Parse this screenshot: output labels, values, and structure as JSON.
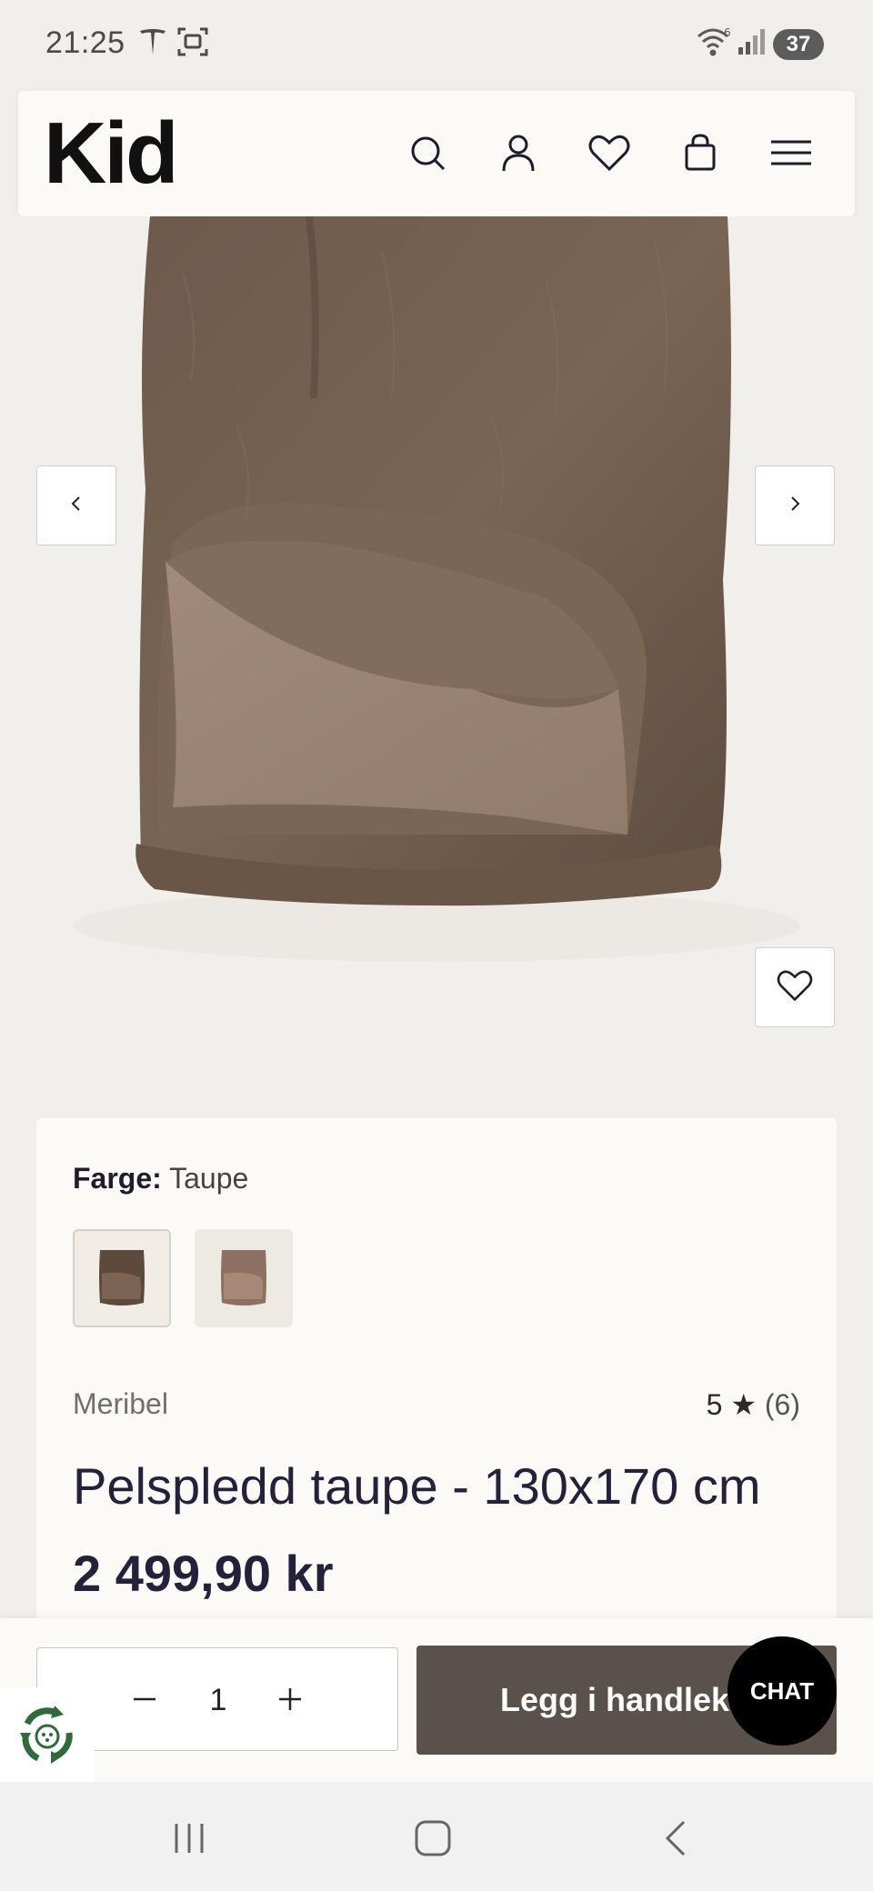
{
  "status_bar": {
    "time": "21:25",
    "battery": "37",
    "icons": [
      "tesla-icon",
      "screenshot-icon",
      "wifi-icon",
      "signal-icon"
    ]
  },
  "header": {
    "logo": "Kid",
    "icons": [
      "search-icon",
      "user-icon",
      "heart-icon",
      "bag-icon",
      "menu-icon"
    ]
  },
  "gallery": {
    "prev_label": "previous image",
    "next_label": "next image"
  },
  "product": {
    "color_label": "Farge:",
    "color_value": "Taupe",
    "brand": "Meribel",
    "rating_value": "5",
    "rating_star": "★",
    "rating_count": "(6)",
    "title": "Pelspledd taupe - 130x170 cm",
    "price": "2 499,90 kr",
    "colors": {
      "fur_dark": "#6e5a4b",
      "fur_mid": "#7d6857",
      "lining": "#a48e7e",
      "swatch_1": "#5e4a3c",
      "swatch_2": "#8c7061"
    }
  },
  "buy": {
    "quantity": "1",
    "add_to_cart": "Legg i handlekurv",
    "chat": "CHAT"
  },
  "colors": {
    "cart_button": "#5b514b",
    "background": "#f1efeb",
    "card": "#fbfaf6"
  }
}
